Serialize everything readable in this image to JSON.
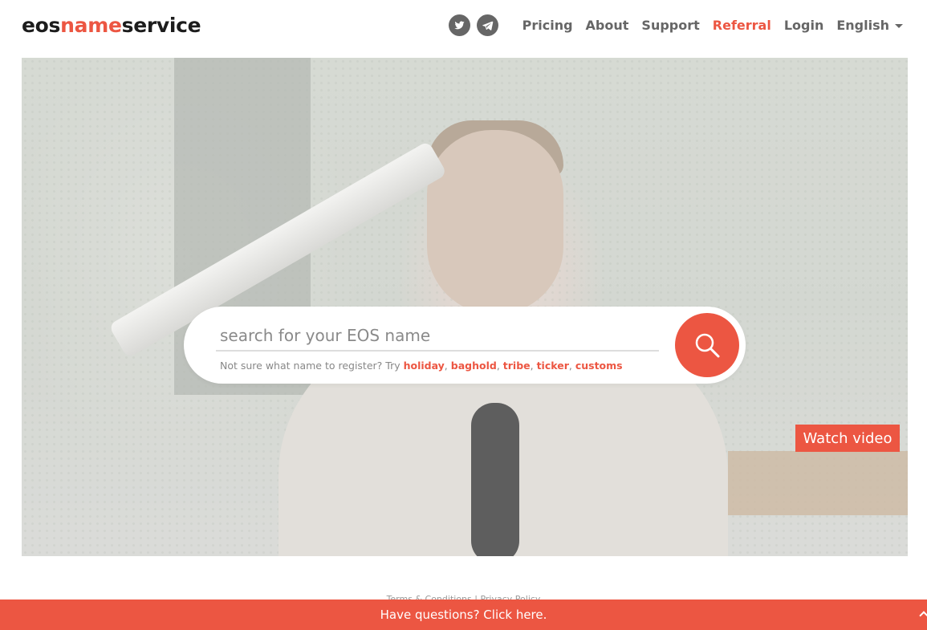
{
  "brand": {
    "part1": "eos",
    "part2": "name",
    "part3": "service"
  },
  "nav": {
    "social": [
      {
        "name": "twitter-icon"
      },
      {
        "name": "telegram-icon"
      }
    ],
    "links": [
      "Pricing",
      "About",
      "Support",
      "Referral",
      "Login"
    ],
    "active_link": "Referral",
    "language": "English"
  },
  "hero": {
    "search_placeholder": "search for your EOS name",
    "hint_prefix": "Not sure what name to register? Try",
    "suggestions": [
      "holiday",
      "baghold",
      "tribe",
      "ticker",
      "customs"
    ],
    "watch_video": "Watch video"
  },
  "footer": {
    "terms": "Terms & Conditions",
    "divider": "|",
    "privacy": "Privacy Policy",
    "question_bar": "Have questions? Click here."
  },
  "colors": {
    "accent": "#ec5642",
    "text": "#666666",
    "logo_dark": "#1c1c1c"
  }
}
